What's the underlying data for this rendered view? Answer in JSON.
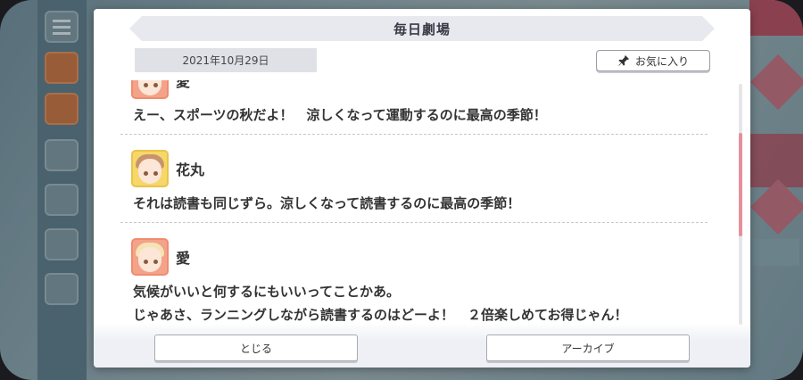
{
  "modal": {
    "title": "毎日劇場",
    "date": "2021年10月29日",
    "favorite_label": "お気に入り",
    "close_label": "とじる",
    "archive_label": "アーカイブ"
  },
  "messages": [
    {
      "speaker": "愛",
      "avatar": "ai",
      "lines": [
        "えー、スポーツの秋だよ！　涼しくなって運動するのに最高の季節！"
      ]
    },
    {
      "speaker": "花丸",
      "avatar": "hanamaru",
      "lines": [
        "それは読書も同じずら。涼しくなって読書するのに最高の季節！"
      ]
    },
    {
      "speaker": "愛",
      "avatar": "ai",
      "lines": [
        "気候がいいと何するにもいいってことかあ。",
        "じゃあさ、ランニングしながら読書するのはどーよ！　２倍楽しめてお得じゃん！"
      ]
    }
  ],
  "icons": {
    "favorite": "pin-icon"
  },
  "colors": {
    "accent_scroll": "#e88f9c",
    "header_bg": "#e7e9ee",
    "date_bg": "#dfe1e6"
  }
}
